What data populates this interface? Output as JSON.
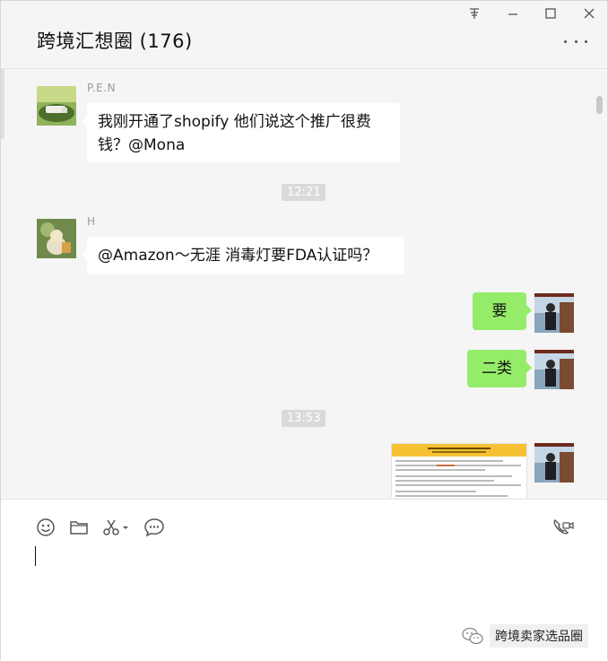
{
  "window": {
    "title": "跨境汇想圈 (176)",
    "controls": [
      "pin-icon",
      "minimize-icon",
      "maximize-icon",
      "close-icon"
    ]
  },
  "messages": [
    {
      "type": "incoming",
      "sender": "P.E.N",
      "lines": [
        "我刚开通了shopify  他们说这个推广很费",
        "钱？@Mona"
      ]
    },
    {
      "type": "timestamp",
      "text": "12:21"
    },
    {
      "type": "incoming",
      "sender": "H",
      "lines": [
        "@Amazon～无涯 消毒灯要FDA认证吗？"
      ]
    },
    {
      "type": "outgoing",
      "text": "要"
    },
    {
      "type": "outgoing",
      "text": "二类"
    },
    {
      "type": "timestamp",
      "text": "13:53"
    },
    {
      "type": "outgoing",
      "attachment": "document-image"
    }
  ],
  "toolbar": {
    "icons": [
      "emoji-icon",
      "folder-icon",
      "scissors-icon",
      "chat-history-icon",
      "video-call-icon"
    ]
  },
  "watermark": {
    "text": "跨境卖家选品圈"
  },
  "colors": {
    "outgoing_bubble": "#95ec69",
    "incoming_bubble": "#ffffff",
    "background": "#f5f5f5"
  }
}
